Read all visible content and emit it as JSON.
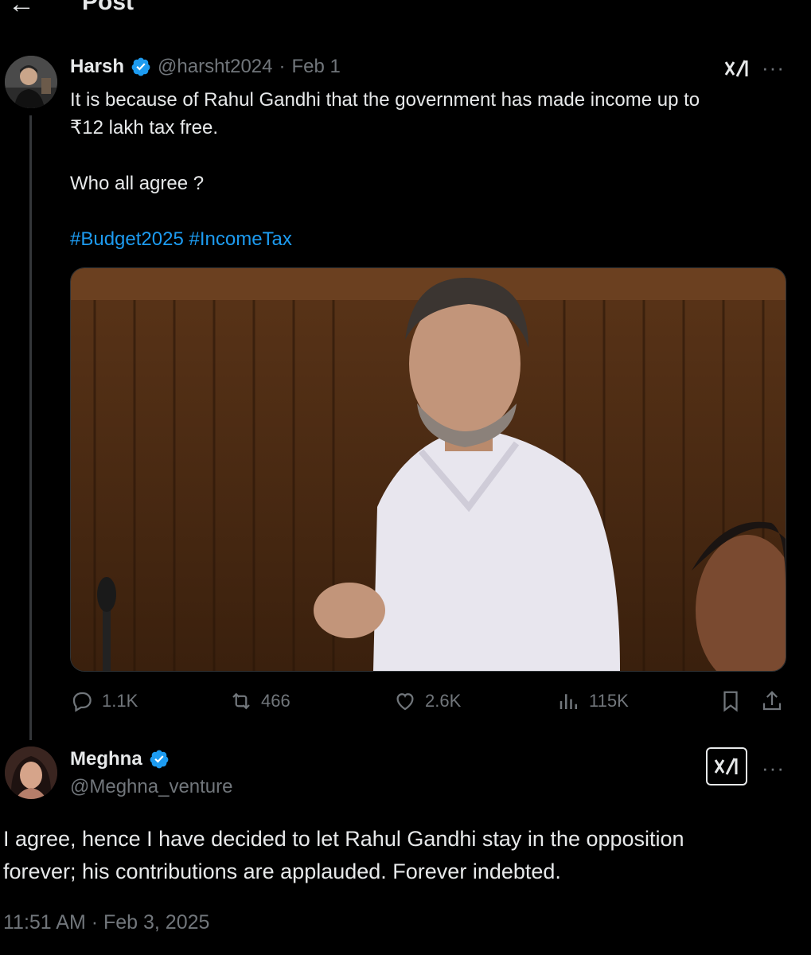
{
  "header": {
    "back_icon": "arrow-left-icon",
    "title": "Post"
  },
  "post": {
    "author_name": "Harsh",
    "handle": "@harsht2024",
    "separator": "·",
    "date": "Feb 1",
    "text_line1": "It is because of Rahul Gandhi that the government has made income up to",
    "text_line2": "₹12 lakh tax free.",
    "text_line3": "Who all agree ?",
    "hashtags": [
      "#Budget2025",
      "#IncomeTax"
    ],
    "stats": {
      "replies": "1.1K",
      "reposts": "466",
      "likes": "2.6K",
      "views": "115K"
    },
    "verified_color": "#1d9bf0"
  },
  "reply": {
    "author_name": "Meghna",
    "handle": "@Meghna_venture",
    "text_line1": "I agree, hence I have decided to let Rahul Gandhi stay in the opposition",
    "text_line2": "forever; his contributions are applauded. Forever indebted.",
    "timestamp": "11:51 AM · Feb 3, 2025"
  },
  "icons": {
    "grok": "grok-icon",
    "more": "more-icon",
    "more_glyph": "···",
    "grok_glyph": "x/|"
  },
  "colors": {
    "background": "#000000",
    "text": "#e7e9ea",
    "muted": "#71767b",
    "accent": "#1d9bf0"
  }
}
